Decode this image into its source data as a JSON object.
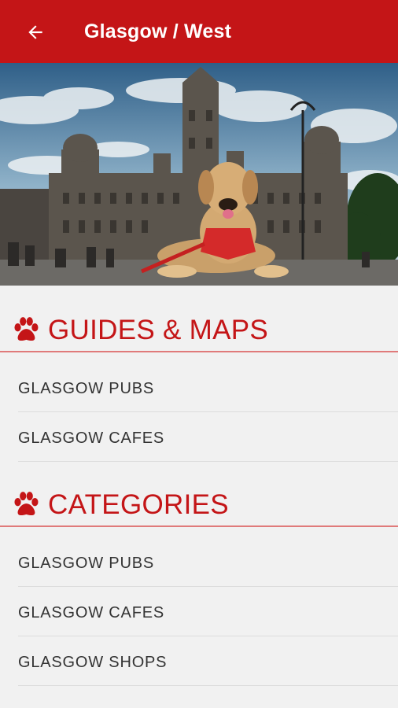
{
  "app_bar": {
    "title": "Glasgow / West",
    "back_icon": "arrow-back-icon",
    "background": "#c41517"
  },
  "hero": {
    "icon": "hero-photo-dog-city-chambers"
  },
  "sections": [
    {
      "icon": "paw-icon",
      "title": "GUIDES & MAPS",
      "items": [
        {
          "label": "GLASGOW PUBS"
        },
        {
          "label": "GLASGOW CAFES"
        }
      ]
    },
    {
      "icon": "paw-icon",
      "title": "CATEGORIES",
      "items": [
        {
          "label": "GLASGOW PUBS"
        },
        {
          "label": "GLASGOW CAFES"
        },
        {
          "label": "GLASGOW SHOPS"
        }
      ]
    }
  ],
  "colors": {
    "accent": "#c41517",
    "divider": "#e07a7a",
    "background": "#f1f1f1"
  }
}
